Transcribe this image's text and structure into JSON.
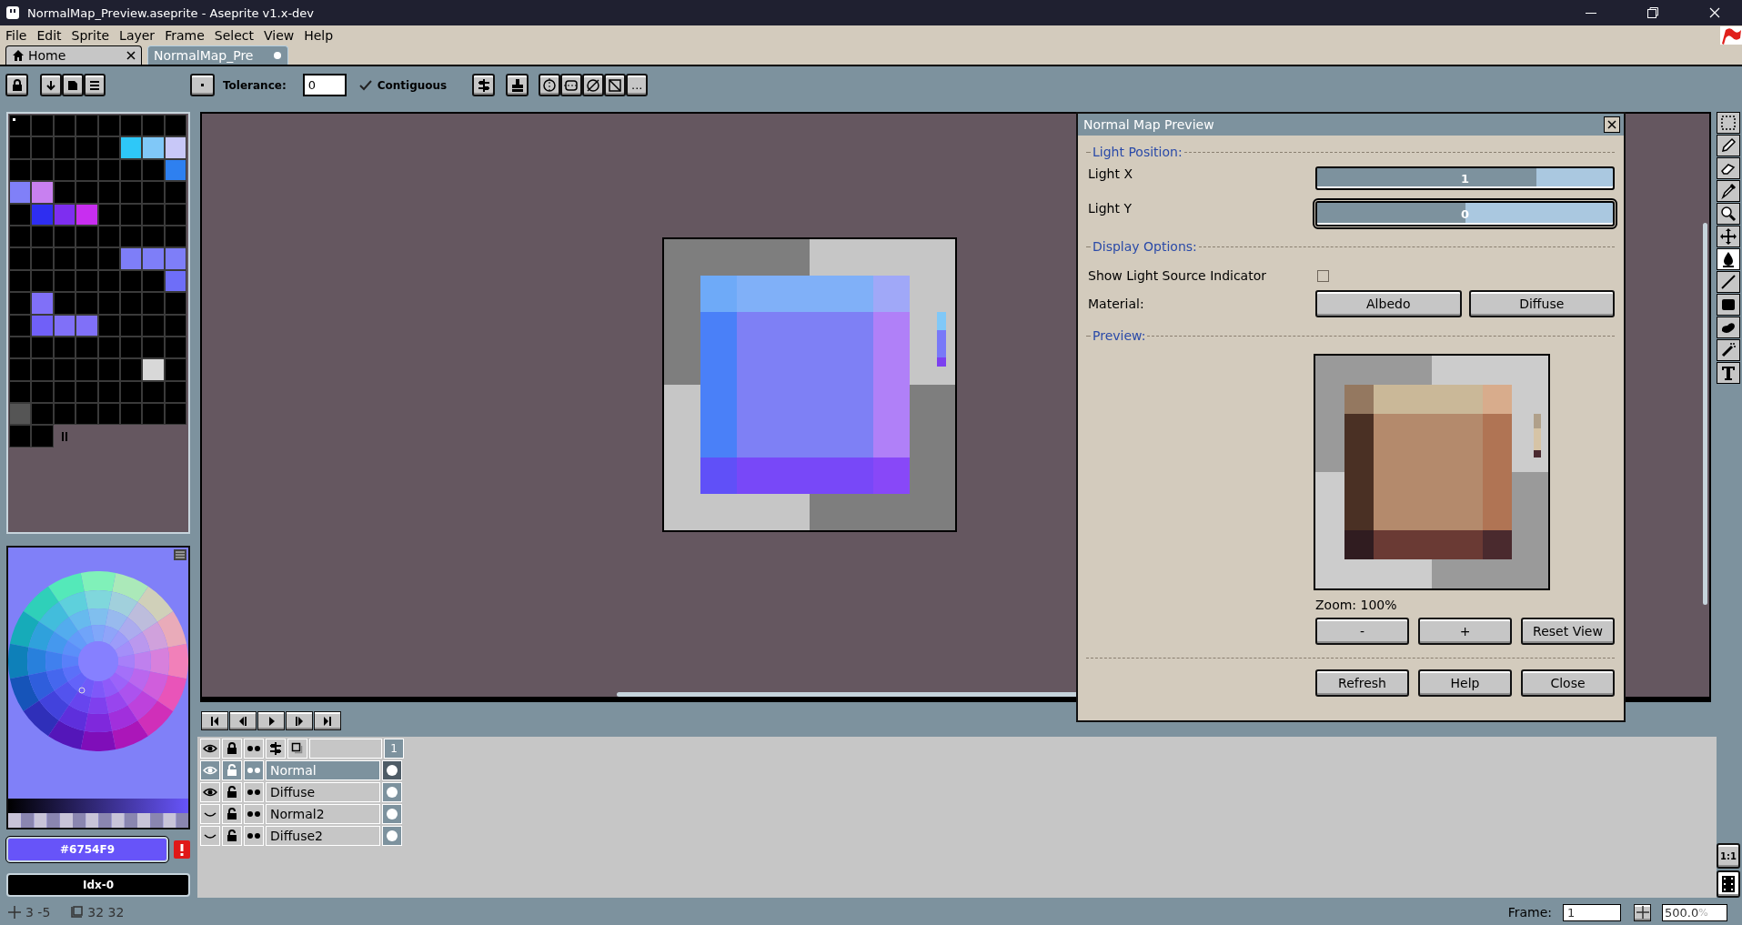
{
  "window": {
    "title": "NormalMap_Preview.aseprite - Aseprite v1.x-dev"
  },
  "menu": [
    {
      "label": "File"
    },
    {
      "label": "Edit"
    },
    {
      "label": "Sprite"
    },
    {
      "label": "Layer"
    },
    {
      "label": "Frame"
    },
    {
      "label": "Select"
    },
    {
      "label": "View"
    },
    {
      "label": "Help"
    }
  ],
  "tabs": [
    {
      "kind": "home",
      "label": "Home",
      "selected": false,
      "modified": false
    },
    {
      "kind": "document",
      "label": "NormalMap_Pre",
      "selected": true,
      "modified": true
    }
  ],
  "toolbar": {
    "tolerance_label": "Tolerance:",
    "tolerance": "0",
    "contiguous": {
      "label": "Contiguous",
      "checked": true
    },
    "more": "..."
  },
  "palette": [
    {
      "color": "#000000",
      "selected": true
    },
    {
      "color": "#000000",
      "selected": false
    },
    {
      "color": "#000000",
      "selected": false
    },
    {
      "color": "#000000",
      "selected": false
    },
    {
      "color": "#000000",
      "selected": false
    },
    {
      "color": "#000000",
      "selected": false
    },
    {
      "color": "#000000",
      "selected": false
    },
    {
      "color": "#000000",
      "selected": false
    },
    {
      "color": "#000000",
      "selected": false
    },
    {
      "color": "#000000",
      "selected": false
    },
    {
      "color": "#000000",
      "selected": false
    },
    {
      "color": "#000000",
      "selected": false
    },
    {
      "color": "#000000",
      "selected": false
    },
    {
      "color": "#2ec8f8",
      "selected": false
    },
    {
      "color": "#80c8f8",
      "selected": false
    },
    {
      "color": "#c8c8f8",
      "selected": false
    },
    {
      "color": "#000000",
      "selected": false
    },
    {
      "color": "#000000",
      "selected": false
    },
    {
      "color": "#000000",
      "selected": false
    },
    {
      "color": "#000000",
      "selected": false
    },
    {
      "color": "#000000",
      "selected": false
    },
    {
      "color": "#000000",
      "selected": false
    },
    {
      "color": "#000000",
      "selected": false
    },
    {
      "color": "#2e80f0",
      "selected": false
    },
    {
      "color": "#8080f8",
      "selected": false
    },
    {
      "color": "#c880f0",
      "selected": false
    },
    {
      "color": "#000000",
      "selected": false
    },
    {
      "color": "#000000",
      "selected": false
    },
    {
      "color": "#000000",
      "selected": false
    },
    {
      "color": "#000000",
      "selected": false
    },
    {
      "color": "#000000",
      "selected": false
    },
    {
      "color": "#000000",
      "selected": false
    },
    {
      "color": "#000000",
      "selected": false
    },
    {
      "color": "#2e2ef0",
      "selected": false
    },
    {
      "color": "#7e2ef0",
      "selected": false
    },
    {
      "color": "#c82ef0",
      "selected": false
    },
    {
      "color": "#000000",
      "selected": false
    },
    {
      "color": "#000000",
      "selected": false
    },
    {
      "color": "#000000",
      "selected": false
    },
    {
      "color": "#000000",
      "selected": false
    },
    {
      "color": "#000000",
      "selected": false
    },
    {
      "color": "#000000",
      "selected": false
    },
    {
      "color": "#000000",
      "selected": false
    },
    {
      "color": "#000000",
      "selected": false
    },
    {
      "color": "#000000",
      "selected": false
    },
    {
      "color": "#000000",
      "selected": false
    },
    {
      "color": "#000000",
      "selected": false
    },
    {
      "color": "#000000",
      "selected": false
    },
    {
      "color": "#000000",
      "selected": false
    },
    {
      "color": "#000000",
      "selected": false
    },
    {
      "color": "#000000",
      "selected": false
    },
    {
      "color": "#000000",
      "selected": false
    },
    {
      "color": "#000000",
      "selected": false
    },
    {
      "color": "#7e7ef8",
      "selected": false
    },
    {
      "color": "#7e7ef8",
      "selected": false
    },
    {
      "color": "#7e7ef8",
      "selected": false
    },
    {
      "color": "#000000",
      "selected": false
    },
    {
      "color": "#000000",
      "selected": false
    },
    {
      "color": "#000000",
      "selected": false
    },
    {
      "color": "#000000",
      "selected": false
    },
    {
      "color": "#000000",
      "selected": false
    },
    {
      "color": "#000000",
      "selected": false
    },
    {
      "color": "#000000",
      "selected": false
    },
    {
      "color": "#6e6ef8",
      "selected": false
    },
    {
      "color": "#000000",
      "selected": false
    },
    {
      "color": "#8070f8",
      "selected": false
    },
    {
      "color": "#000000",
      "selected": false
    },
    {
      "color": "#000000",
      "selected": false
    },
    {
      "color": "#000000",
      "selected": false
    },
    {
      "color": "#000000",
      "selected": false
    },
    {
      "color": "#000000",
      "selected": false
    },
    {
      "color": "#000000",
      "selected": false
    },
    {
      "color": "#000000",
      "selected": false
    },
    {
      "color": "#7060f8",
      "selected": false
    },
    {
      "color": "#8070f8",
      "selected": false
    },
    {
      "color": "#8070f8",
      "selected": false
    },
    {
      "color": "#000000",
      "selected": false
    },
    {
      "color": "#000000",
      "selected": false
    },
    {
      "color": "#000000",
      "selected": false
    },
    {
      "color": "#000000",
      "selected": false
    },
    {
      "color": "#000000",
      "selected": false
    },
    {
      "color": "#000000",
      "selected": false
    },
    {
      "color": "#000000",
      "selected": false
    },
    {
      "color": "#000000",
      "selected": false
    },
    {
      "color": "#000000",
      "selected": false
    },
    {
      "color": "#000000",
      "selected": false
    },
    {
      "color": "#000000",
      "selected": false
    },
    {
      "color": "#000000",
      "selected": false
    },
    {
      "color": "#000000",
      "selected": false
    },
    {
      "color": "#000000",
      "selected": false
    },
    {
      "color": "#000000",
      "selected": false
    },
    {
      "color": "#000000",
      "selected": false
    },
    {
      "color": "#000000",
      "selected": false
    },
    {
      "color": "#000000",
      "selected": false
    },
    {
      "color": "#d8d8d8",
      "selected": false
    },
    {
      "color": "#000000",
      "selected": false
    },
    {
      "color": "#000000",
      "selected": false
    },
    {
      "color": "#000000",
      "selected": false
    },
    {
      "color": "#000000",
      "selected": false
    },
    {
      "color": "#000000",
      "selected": false
    },
    {
      "color": "#000000",
      "selected": false
    },
    {
      "color": "#000000",
      "selected": false
    },
    {
      "color": "#000000",
      "selected": false
    },
    {
      "color": "#000000",
      "selected": false
    },
    {
      "color": "#555555",
      "selected": false
    },
    {
      "color": "#000000",
      "selected": false
    },
    {
      "color": "#000000",
      "selected": false
    },
    {
      "color": "#000000",
      "selected": false
    },
    {
      "color": "#000000",
      "selected": false
    },
    {
      "color": "#000000",
      "selected": false
    },
    {
      "color": "#000000",
      "selected": false
    },
    {
      "color": "#000000",
      "selected": false
    },
    {
      "color": "#000000",
      "selected": false
    },
    {
      "color": "#000000",
      "selected": false
    }
  ],
  "color_bar": {
    "hex": "#6754F9",
    "color": "#6754f9",
    "index": "Idx-0"
  },
  "timeline": {
    "frames": [
      {
        "label": "1",
        "selected": true
      }
    ],
    "layers": [
      {
        "name": "Normal",
        "visible": true,
        "selected": true
      },
      {
        "name": "Diffuse",
        "visible": true,
        "selected": false
      },
      {
        "name": "Normal2",
        "visible": false,
        "selected": false
      },
      {
        "name": "Diffuse2",
        "visible": false,
        "selected": false
      }
    ]
  },
  "tools": [
    {
      "kind": "marquee",
      "selected": false
    },
    {
      "kind": "pencil",
      "selected": false
    },
    {
      "kind": "eraser",
      "selected": false
    },
    {
      "kind": "eyedropper",
      "selected": false
    },
    {
      "kind": "zoom",
      "selected": false
    },
    {
      "kind": "move",
      "selected": false
    },
    {
      "kind": "bucket",
      "selected": true
    },
    {
      "kind": "line",
      "selected": false
    },
    {
      "kind": "rectangle",
      "selected": false
    },
    {
      "kind": "contour",
      "selected": false
    },
    {
      "kind": "spray",
      "selected": false
    },
    {
      "kind": "text",
      "selected": false
    }
  ],
  "dialog": {
    "title": "Normal Map Preview",
    "light_position": {
      "heading": "Light Position:",
      "sliders": [
        {
          "label": "Light X",
          "value": "1",
          "level": 0.74,
          "focused": false
        },
        {
          "label": "Light Y",
          "value": "0",
          "level": 0.5,
          "focused": true
        }
      ]
    },
    "display_options": {
      "heading": "Display Options:",
      "indicator": {
        "label": "Show Light Source Indicator",
        "checked": false
      },
      "material_label": "Material:",
      "materials": [
        {
          "label": "Albedo"
        },
        {
          "label": "Diffuse"
        }
      ]
    },
    "preview": {
      "heading": "Preview:",
      "zoom": "Zoom: 100%",
      "zoom_buttons": [
        {
          "label": "-"
        },
        {
          "label": "+"
        },
        {
          "label": "Reset View"
        }
      ]
    },
    "buttons": [
      {
        "label": "Refresh"
      },
      {
        "label": "Help"
      },
      {
        "label": "Close"
      }
    ]
  },
  "zoom_reset": "1:1",
  "status_bar": {
    "position": "3 -5",
    "size": "32 32",
    "frame_label": "Frame:",
    "frame": "1",
    "zoom": "500.0",
    "zoom_unit": "%"
  }
}
